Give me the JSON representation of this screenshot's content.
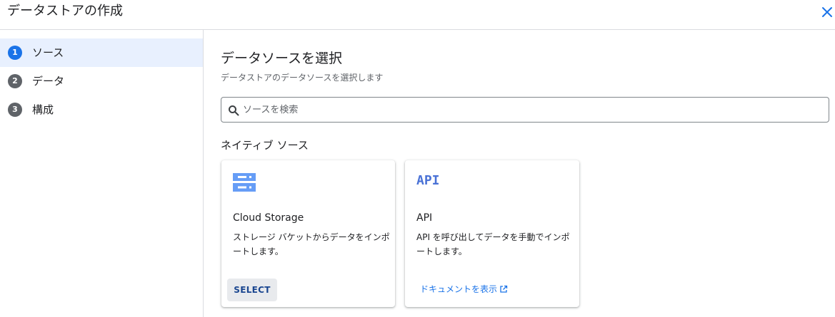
{
  "window": {
    "title": "データストアの作成",
    "close_icon": "close-icon"
  },
  "colors": {
    "accent": "#1a73e8",
    "active_step_bg": "#e8f0fe",
    "step_inactive": "#5f6368"
  },
  "steps": [
    {
      "number": "1",
      "label": "ソース",
      "active": true
    },
    {
      "number": "2",
      "label": "データ",
      "active": false
    },
    {
      "number": "3",
      "label": "構成",
      "active": false
    }
  ],
  "main": {
    "heading": "データソースを選択",
    "subheading": "データストアのデータソースを選択します",
    "search": {
      "placeholder": "ソースを検索",
      "value": "",
      "icon": "search-icon"
    },
    "section_title": "ネイティブ ソース",
    "cards": [
      {
        "icon": "storage-icon",
        "title": "Cloud Storage",
        "description": "ストレージ バケットからデータをインポートします。",
        "action_label": "SELECT"
      },
      {
        "icon": "api-icon",
        "icon_text": "API",
        "title": "API",
        "description": "API を呼び出してデータを手動でインポートします。",
        "link_label": "ドキュメントを表示",
        "link_icon": "external-link-icon"
      }
    ]
  }
}
